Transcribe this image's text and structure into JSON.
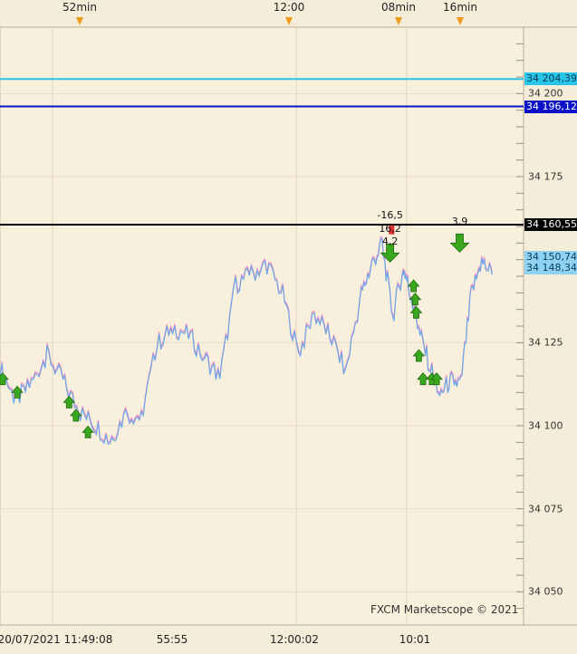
{
  "chart_data": {
    "type": "line",
    "title": "",
    "xlabel": "",
    "ylabel": "",
    "ylim": [
      34040,
      34220
    ],
    "grid": true,
    "watermark": "FXCM Marketscope © 2021",
    "top_labels": [
      "52min",
      "12:00",
      "08min",
      "16min"
    ],
    "bottom_labels": [
      "20/07/2021 11:49:08",
      "55:55",
      "12:00:02",
      "10:01"
    ],
    "y_tick_labels": [
      "34 200",
      "34 175",
      "34 125",
      "34 100",
      "34 075",
      "34 050"
    ],
    "y_ticks": [
      34200,
      34175,
      34125,
      34100,
      34075,
      34050
    ],
    "levels": [
      {
        "label": "34 204,39",
        "value": 34204.39,
        "color": "#29c5e6",
        "text_color": "#0a3a5c"
      },
      {
        "label": "34 196,12",
        "value": 34196.12,
        "color": "#0a10c8",
        "text_color": "#ffffff"
      },
      {
        "label": "34 160,55",
        "value": 34160.55,
        "color": "#000000",
        "text_color": "#ffffff"
      }
    ],
    "price_labels": [
      {
        "label": "34 150,74",
        "value": 34150.74,
        "color": "#8fd3f4",
        "text_color": "#0a3a5c"
      },
      {
        "label": "34 148,34",
        "value": 34148.34,
        "color": "#8fd3f4",
        "text_color": "#0a3a5c"
      }
    ],
    "series": [
      {
        "color": "#f28ac4"
      },
      {
        "color": "#6aa8e8"
      }
    ],
    "x_range": [
      0,
      100
    ],
    "x": [
      0,
      3,
      6,
      9,
      12,
      15,
      18,
      21,
      24,
      27,
      30,
      33,
      36,
      39,
      42,
      45,
      48,
      51,
      54,
      57,
      60,
      63,
      66,
      69,
      71,
      73,
      75,
      77,
      78,
      80,
      82,
      84,
      86,
      88,
      90,
      92,
      94
    ],
    "values": [
      34118,
      34108,
      34113,
      34122,
      34114,
      34105,
      34101,
      34096,
      34104,
      34103,
      34125,
      34130,
      34128,
      34121,
      34115,
      34143,
      34146,
      34149,
      34140,
      34122,
      34134,
      34128,
      34117,
      34140,
      34149,
      34155,
      34133,
      34148,
      34143,
      34129,
      34119,
      34110,
      34114,
      34113,
      34140,
      34150,
      34146
    ],
    "annotations": [
      {
        "text": "-16,5",
        "x": 74.5,
        "value": 34163
      },
      {
        "text": "16,2",
        "x": 74.5,
        "value": 34159
      },
      {
        "text": "4,2",
        "x": 74.5,
        "value": 34155
      },
      {
        "text": "3,9",
        "x": 87.8,
        "value": 34161
      }
    ],
    "buy_arrows": [
      {
        "x": 0.5,
        "value": 34114
      },
      {
        "x": 3.3,
        "value": 34110
      },
      {
        "x": 13.2,
        "value": 34107
      },
      {
        "x": 14.5,
        "value": 34103
      },
      {
        "x": 16.8,
        "value": 34098
      },
      {
        "x": 79.0,
        "value": 34142
      },
      {
        "x": 79.3,
        "value": 34138
      },
      {
        "x": 79.5,
        "value": 34134
      },
      {
        "x": 80.0,
        "value": 34121
      },
      {
        "x": 80.8,
        "value": 34114
      },
      {
        "x": 82.5,
        "value": 34114
      },
      {
        "x": 83.4,
        "value": 34114
      }
    ],
    "sell_arrows": [
      {
        "x": 74.5,
        "value": 34152
      },
      {
        "x": 87.8,
        "value": 34155
      }
    ],
    "red_markers": [
      {
        "x": 74.8,
        "value": 34159
      }
    ]
  }
}
